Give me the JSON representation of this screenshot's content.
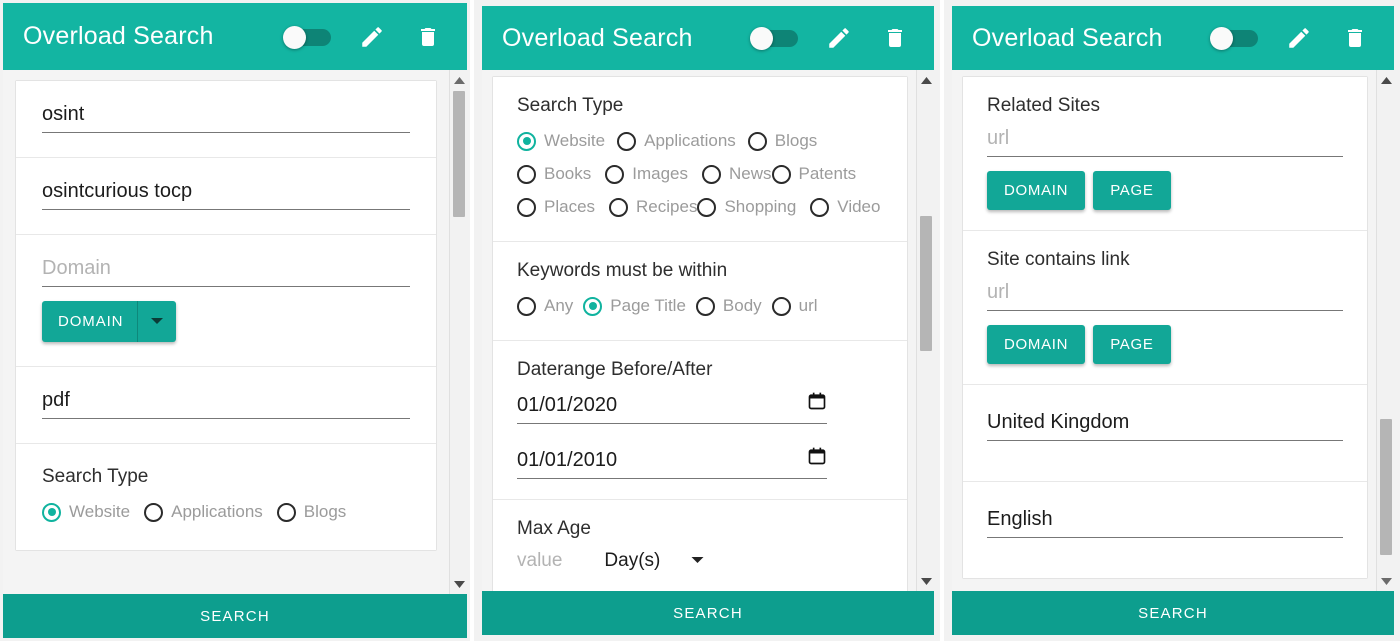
{
  "app": {
    "title": "Overload Search",
    "accent": "#13b5a2",
    "accent_dark": "#0d9e8e",
    "button_teal": "#12a797",
    "radio_on": "#10b39f",
    "toggle_state": "off",
    "icons": {
      "toggle": "toggle-switch-icon",
      "edit": "pencil-icon",
      "delete": "trash-icon",
      "calendar": "calendar-icon",
      "caret": "chevron-down-icon",
      "scroll_up": "scroll-up-arrow-icon",
      "scroll_down": "scroll-down-arrow-icon"
    },
    "search_button": "SEARCH"
  },
  "panel1": {
    "fields": {
      "keyword1": {
        "value": "osint",
        "placeholder": ""
      },
      "keyword2": {
        "value": "osintcurious tocp",
        "placeholder": ""
      },
      "domain": {
        "value": "",
        "placeholder": "Domain"
      },
      "filetype": {
        "value": "pdf",
        "placeholder": ""
      }
    },
    "domain_button": {
      "label": "DOMAIN",
      "caret": "chevron-down-icon"
    },
    "search_type": {
      "label": "Search Type",
      "options": [
        {
          "label": "Website",
          "selected": true
        },
        {
          "label": "Applications",
          "selected": false
        },
        {
          "label": "Blogs",
          "selected": false
        }
      ]
    },
    "scroll": {
      "thumb_top_pct": 4,
      "thumb_height_pct": 24
    }
  },
  "panel2": {
    "search_type": {
      "label": "Search Type",
      "options": [
        {
          "label": "Website",
          "selected": true
        },
        {
          "label": "Applications",
          "selected": false
        },
        {
          "label": "Blogs",
          "selected": false
        },
        {
          "label": "Books",
          "selected": false
        },
        {
          "label": "Images",
          "selected": false
        },
        {
          "label": "News",
          "selected": false
        },
        {
          "label": "Patents",
          "selected": false
        },
        {
          "label": "Places",
          "selected": false
        },
        {
          "label": "Recipes",
          "selected": false
        },
        {
          "label": "Shopping",
          "selected": false
        },
        {
          "label": "Video",
          "selected": false
        }
      ]
    },
    "keywords_within": {
      "label": "Keywords must be within",
      "options": [
        {
          "label": "Any",
          "selected": false
        },
        {
          "label": "Page Title",
          "selected": true
        },
        {
          "label": "Body",
          "selected": false
        },
        {
          "label": "url",
          "selected": false
        }
      ]
    },
    "daterange": {
      "label": "Daterange Before/After",
      "before": "01/01/2020",
      "after": "01/01/2010"
    },
    "max_age": {
      "label": "Max Age",
      "value_placeholder": "value",
      "unit": "Day(s)"
    },
    "scroll": {
      "thumb_top_pct": 28,
      "thumb_height_pct": 26
    }
  },
  "panel3": {
    "related_sites": {
      "label": "Related Sites",
      "url_placeholder": "url",
      "buttons": [
        "DOMAIN",
        "PAGE"
      ]
    },
    "site_contains_link": {
      "label": "Site contains link",
      "url_placeholder": "url",
      "buttons": [
        "DOMAIN",
        "PAGE"
      ]
    },
    "country": {
      "value": "United Kingdom",
      "placeholder": ""
    },
    "language": {
      "value": "English",
      "placeholder": ""
    },
    "scroll": {
      "thumb_top_pct": 67,
      "thumb_height_pct": 26
    }
  }
}
